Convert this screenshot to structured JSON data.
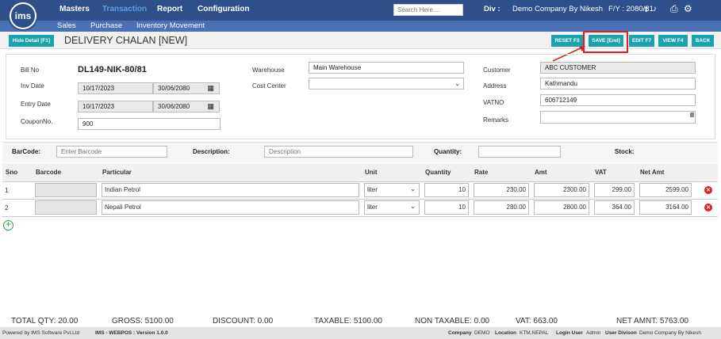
{
  "nav": {
    "logo_text": "ims",
    "menus": [
      "Masters",
      "Transaction",
      "Report",
      "Configuration"
    ],
    "submenus": [
      "Sales",
      "Purchase",
      "Inventory Movement"
    ],
    "search_placeholder": "Search Here....",
    "div_label": "Div :",
    "div_value": "Demo Company By Nikesh",
    "fy": "F/Y : 2080/81"
  },
  "title": {
    "hide_detail": "Hide Detail [F1]",
    "page_title": "DELIVERY CHALAN [NEW]",
    "buttons": [
      "RESET F3",
      "SAVE [End]",
      "EDIT F7",
      "VIEW F4",
      "BACK"
    ]
  },
  "form": {
    "bill_no_label": "Bill No",
    "bill_no": "DL149-NIK-80/81",
    "inv_date_label": "Inv Date",
    "inv_date": "10/17/2023",
    "inv_date_bs": "30/06/2080",
    "entry_date_label": "Entry Date",
    "entry_date": "10/17/2023",
    "entry_date_bs": "30/06/2080",
    "coupon_label": "CouponNo.",
    "coupon": "900",
    "warehouse_label": "Warehouse",
    "warehouse": "Main Warehouse",
    "cost_center_label": "Cost Center",
    "customer_label": "Customer",
    "customer": "ABC CUSTOMER",
    "address_label": "Address",
    "address": "Kathmandu",
    "vat_label": "VATNO",
    "vat": "606712149",
    "remarks_label": "Remarks"
  },
  "entry": {
    "barcode_label": "BarCode:",
    "barcode_placeholder": "Enter Barcode",
    "desc_label": "Description:",
    "desc_placeholder": "Description",
    "qty_label": "Quantity:",
    "stock_label": "Stock:"
  },
  "table": {
    "headers": [
      "Sno",
      "Barcode",
      "Particular",
      "Unit",
      "Quantity",
      "Rate",
      "Amt",
      "VAT",
      "Net Amt"
    ],
    "rows": [
      {
        "sno": "1",
        "particular": "Indian Petrol",
        "unit": "liter",
        "qty": "10",
        "rate": "230.00",
        "amt": "2300.00",
        "vat": "299.00",
        "net": "2599.00"
      },
      {
        "sno": "2",
        "particular": "Nepali Petrol",
        "unit": "liter",
        "qty": "10",
        "rate": "280.00",
        "amt": "2800.00",
        "vat": "364.00",
        "net": "3164.00"
      }
    ]
  },
  "totals": {
    "qty": "TOTAL QTY: 20.00",
    "gross": "GROSS: 5100.00",
    "discount": "DISCOUNT: 0.00",
    "taxable": "TAXABLE: 5100.00",
    "non_taxable": "NON TAXABLE: 0.00",
    "vat": "VAT: 663.00",
    "net": "NET AMNT: 5763.00"
  },
  "footer": {
    "powered": "Powered by IMS Software Pvt.Ltd",
    "version": "IMS - WEBPOS : Version 1.0.0",
    "company_label": "Company",
    "company": "DEMO",
    "location_label": "Location",
    "location": "KTM,NEPAL",
    "user_label": "Login User",
    "user": "Admin",
    "division_label": "User Divison",
    "division": "Demo Company By Nikesh"
  },
  "colors": {
    "nav": "#2f4f8a",
    "subnav": "#4a70b5",
    "button": "#1aa3ad",
    "highlight": "#e02020"
  }
}
